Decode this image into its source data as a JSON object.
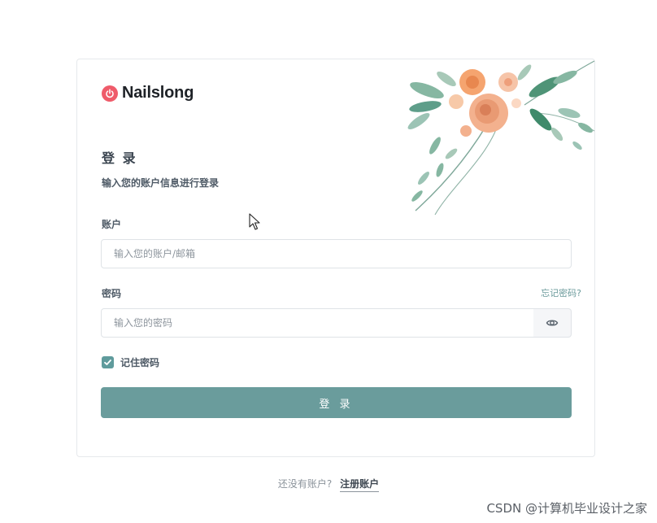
{
  "brand": {
    "name": "Nailslong",
    "logo_icon": "power-icon",
    "logo_color": "#ef5b6a"
  },
  "form": {
    "title": "登 录",
    "subtitle": "输入您的账户信息进行登录",
    "account": {
      "label": "账户",
      "placeholder": "输入您的账户/邮箱",
      "value": ""
    },
    "password": {
      "label": "密码",
      "placeholder": "输入您的密码",
      "value": "",
      "forgot_label": "忘记密码?",
      "toggle_icon": "eye-icon"
    },
    "remember": {
      "label": "记住密码",
      "checked": true
    },
    "submit_label": "登 录"
  },
  "footer": {
    "prompt": "还没有账户?",
    "register_link": "注册账户"
  },
  "watermark": "CSDN @计算机毕业设计之家",
  "colors": {
    "accent": "#6a9c9c",
    "checkbox": "#5f9b9c",
    "link": "#6a9a9b"
  }
}
